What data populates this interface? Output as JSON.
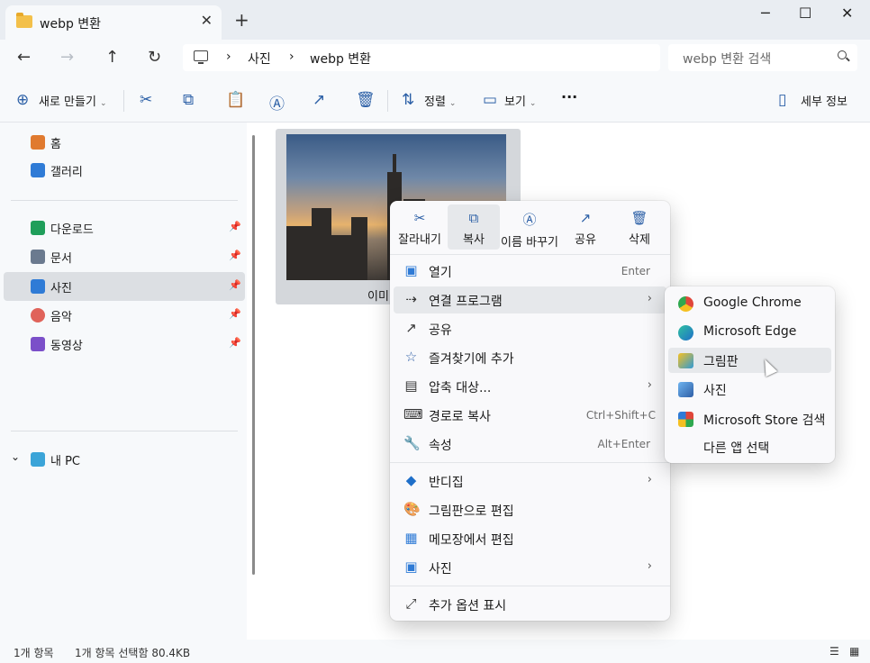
{
  "window": {
    "tab_title": "webp 변환",
    "close_tab": "✕",
    "new_tab": "+",
    "minimize": "─",
    "maximize": "☐",
    "close": "✕"
  },
  "nav": {
    "back": "←",
    "forward": "→",
    "up": "↑",
    "refresh": "↻",
    "breadcrumb": [
      "사진",
      "webp 변환"
    ],
    "separator": "›",
    "search_placeholder": "webp 변환 검색"
  },
  "toolbar": {
    "new": "새로 만들기",
    "sort": "정렬",
    "view": "보기",
    "more": "···",
    "details": "세부 정보"
  },
  "sidebar": {
    "quick": [
      {
        "label": "홈",
        "color": "#e07a2f"
      },
      {
        "label": "갤러리",
        "color": "#2f7bd6"
      }
    ],
    "pinned": [
      {
        "label": "다운로드",
        "color": "#1f9e5a"
      },
      {
        "label": "문서",
        "color": "#6b7a8f"
      },
      {
        "label": "사진",
        "color": "#2f7bd6",
        "selected": true
      },
      {
        "label": "음악",
        "color": "#e0635a"
      },
      {
        "label": "동영상",
        "color": "#7b4fc9"
      }
    ],
    "pc": "내 PC"
  },
  "content": {
    "file_name": "이미"
  },
  "context_menu": {
    "quick_actions": [
      {
        "icon": "✂",
        "label": "잘라내기"
      },
      {
        "icon": "⧉",
        "label": "복사",
        "selected": true
      },
      {
        "icon": "Ⓐ",
        "label": "이름 바꾸기"
      },
      {
        "icon": "↗",
        "label": "공유"
      },
      {
        "icon": "🗑",
        "label": "삭제"
      }
    ],
    "items": [
      {
        "icon": "▣",
        "label": "열기",
        "shortcut": "Enter"
      },
      {
        "icon": "⇢",
        "label": "연결 프로그램",
        "arrow": "›",
        "selected": true
      },
      {
        "icon": "↗",
        "label": "공유"
      },
      {
        "icon": "☆",
        "label": "즐겨찾기에 추가"
      },
      {
        "icon": "▤",
        "label": "압축 대상...",
        "arrow": "›"
      },
      {
        "icon": "⌨",
        "label": "경로로 복사",
        "shortcut": "Ctrl+Shift+C"
      },
      {
        "icon": "🔧",
        "label": "속성",
        "shortcut": "Alt+Enter"
      },
      {
        "icon": "◆",
        "label": "반디집",
        "arrow": "›"
      },
      {
        "icon": "🎨",
        "label": "그림판으로 편집"
      },
      {
        "icon": "▦",
        "label": "메모장에서 편집"
      },
      {
        "icon": "▣",
        "label": "사진",
        "arrow": "›"
      },
      {
        "icon": "⤢",
        "label": "추가 옵션 표시"
      }
    ]
  },
  "submenu": {
    "items": [
      {
        "label": "Google Chrome",
        "color": "#e0463a"
      },
      {
        "label": "Microsoft Edge",
        "color": "#1f8fc9"
      },
      {
        "label": "그림판",
        "color": "#2f9ad6",
        "selected": true
      },
      {
        "label": "사진",
        "color": "#2f7bd6"
      },
      {
        "label": "Microsoft Store 검색",
        "color": "#2f6fb0"
      },
      {
        "label": "다른 앱 선택",
        "color": ""
      }
    ]
  },
  "status": {
    "count": "1개 항목",
    "selected": "1개 항목 선택함 80.4KB"
  }
}
